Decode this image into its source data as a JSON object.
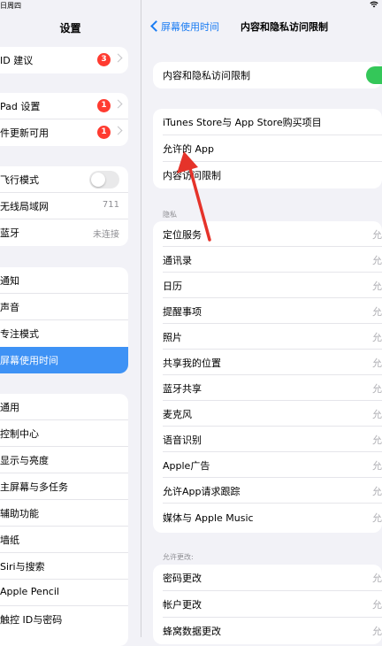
{
  "status_bar": {
    "time": "日周四"
  },
  "sidebar": {
    "title": "设置",
    "groups": [
      [
        {
          "label": "ID 建议",
          "badge": "3"
        }
      ],
      [
        {
          "label": "Pad 设置",
          "badge": "1"
        },
        {
          "label": "件更新可用",
          "badge": "1"
        }
      ],
      [
        {
          "label": "飞行模式"
        },
        {
          "label": "无线局域网",
          "value": "711"
        },
        {
          "label": "蓝牙",
          "value": "未连接"
        }
      ],
      [
        {
          "label": "通知"
        },
        {
          "label": "声音"
        },
        {
          "label": "专注模式"
        },
        {
          "label": "屏幕使用时间",
          "selected": true
        }
      ],
      [
        {
          "label": "通用"
        },
        {
          "label": "控制中心"
        },
        {
          "label": "显示与亮度"
        },
        {
          "label": "主屏幕与多任务"
        },
        {
          "label": "辅助功能"
        },
        {
          "label": "墙纸"
        },
        {
          "label": "Siri与搜索"
        },
        {
          "label": "Apple Pencil"
        },
        {
          "label": "触控 ID与密码"
        }
      ]
    ]
  },
  "nav": {
    "back_label": "屏幕使用时间",
    "title": "内容和隐私访问限制"
  },
  "main": {
    "toggle_row": {
      "label": "内容和隐私访问限制",
      "state": "on"
    },
    "group2": [
      "iTunes Store与 App Store购买项目",
      "允许的 App",
      "内容访问限制"
    ],
    "privacy_header": "隐私",
    "privacy": [
      "定位服务",
      "通讯录",
      "日历",
      "提醒事项",
      "照片",
      "共享我的位置",
      "蓝牙共享",
      "麦克风",
      "语音识别",
      "Apple广告",
      "允许App请求跟踪",
      "媒体与 Apple Music"
    ],
    "trailing_glyph": "允",
    "allow_changes_header": "允许更改:",
    "allow_changes": [
      "密码更改",
      "帐户更改",
      "蜂窝数据更改"
    ]
  },
  "colors": {
    "accent": "#1a7cf3",
    "selected": "#3e92f5",
    "badge": "#ff3b30",
    "toggle_on": "#34c759",
    "arrow": "#e5332a"
  }
}
